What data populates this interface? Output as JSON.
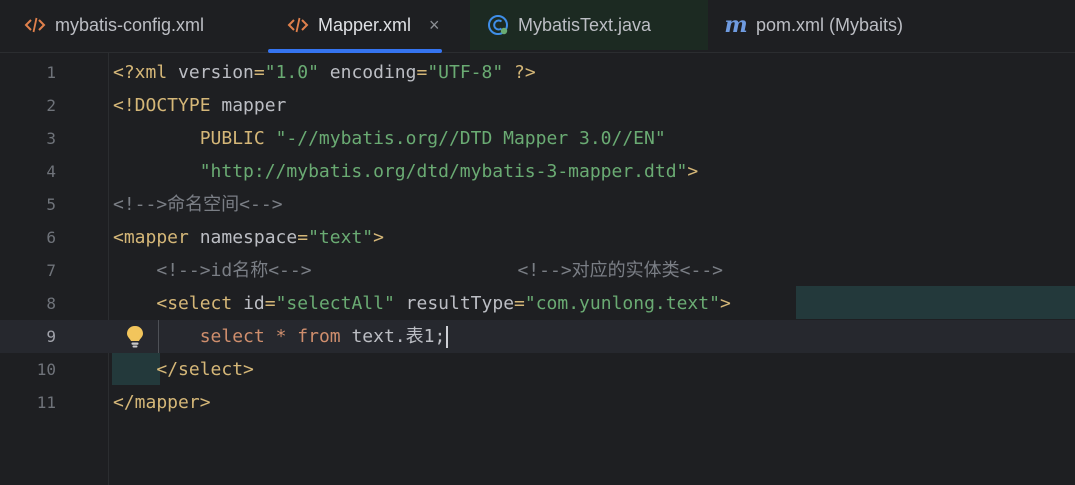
{
  "tabs": [
    {
      "label": "mybatis-config.xml",
      "icon": "xml-tag-icon",
      "active": false
    },
    {
      "label": "Mapper.xml",
      "icon": "xml-tag-icon",
      "active": true,
      "close": "×"
    },
    {
      "label": "MybatisText.java",
      "icon": "java-class-icon",
      "active": false
    },
    {
      "label": "pom.xml (Mybaits)",
      "icon": "maven-icon",
      "active": false
    }
  ],
  "editor": {
    "current_line": 9,
    "line_numbers": [
      "1",
      "2",
      "3",
      "4",
      "5",
      "6",
      "7",
      "8",
      "9",
      "10",
      "11"
    ],
    "lines": [
      [
        {
          "t": "tag",
          "v": "<?xml "
        },
        {
          "t": "attr",
          "v": "version"
        },
        {
          "t": "tag",
          "v": "="
        },
        {
          "t": "str",
          "v": "\"1.0\""
        },
        {
          "t": "plain",
          "v": " "
        },
        {
          "t": "attr",
          "v": "encoding"
        },
        {
          "t": "tag",
          "v": "="
        },
        {
          "t": "str",
          "v": "\"UTF-8\""
        },
        {
          "t": "tag",
          "v": " ?>"
        }
      ],
      [
        {
          "t": "tag",
          "v": "<!DOCTYPE "
        },
        {
          "t": "plain",
          "v": "mapper"
        }
      ],
      [
        {
          "t": "plain",
          "v": "        "
        },
        {
          "t": "tag",
          "v": "PUBLIC "
        },
        {
          "t": "str",
          "v": "\"-//mybatis.org//DTD Mapper 3.0//EN\""
        }
      ],
      [
        {
          "t": "plain",
          "v": "        "
        },
        {
          "t": "str",
          "v": "\"http://mybatis.org/dtd/mybatis-3-mapper.dtd\""
        },
        {
          "t": "tag",
          "v": ">"
        }
      ],
      [
        {
          "t": "cmt",
          "v": "<!-->命名空间<-->"
        }
      ],
      [
        {
          "t": "tag",
          "v": "<mapper "
        },
        {
          "t": "attr",
          "v": "namespace"
        },
        {
          "t": "tag",
          "v": "="
        },
        {
          "t": "str",
          "v": "\"text\""
        },
        {
          "t": "tag",
          "v": ">"
        }
      ],
      [
        {
          "t": "plain",
          "v": "    "
        },
        {
          "t": "cmt",
          "v": "<!-->id名称<-->                   <!-->对应的实体类<-->"
        }
      ],
      [
        {
          "t": "plain",
          "v": "    "
        },
        {
          "t": "tag",
          "v": "<select "
        },
        {
          "t": "attr",
          "v": "id"
        },
        {
          "t": "tag",
          "v": "="
        },
        {
          "t": "str",
          "v": "\"selectAll\""
        },
        {
          "t": "plain",
          "v": " "
        },
        {
          "t": "attr",
          "v": "resultType"
        },
        {
          "t": "tag",
          "v": "="
        },
        {
          "t": "str",
          "v": "\"com.yunlong.text\""
        },
        {
          "t": "tag",
          "v": ">"
        }
      ],
      [
        {
          "t": "plain",
          "v": "        "
        },
        {
          "t": "kw",
          "v": "select"
        },
        {
          "t": "plain",
          "v": " "
        },
        {
          "t": "kw",
          "v": "*"
        },
        {
          "t": "plain",
          "v": " "
        },
        {
          "t": "kw",
          "v": "from"
        },
        {
          "t": "plain",
          "v": " text.表1;"
        }
      ],
      [
        {
          "t": "plain",
          "v": "    "
        },
        {
          "t": "tag",
          "v": "</select>"
        }
      ],
      [
        {
          "t": "tag",
          "v": "</mapper>"
        }
      ]
    ]
  },
  "colors": {
    "background": "#1e1f22",
    "accent": "#3574f0",
    "tag": "#d5b778",
    "string": "#6aab73",
    "comment": "#7a7e85",
    "keyword": "#cf8e6d",
    "bulb": "#f2c55c"
  }
}
